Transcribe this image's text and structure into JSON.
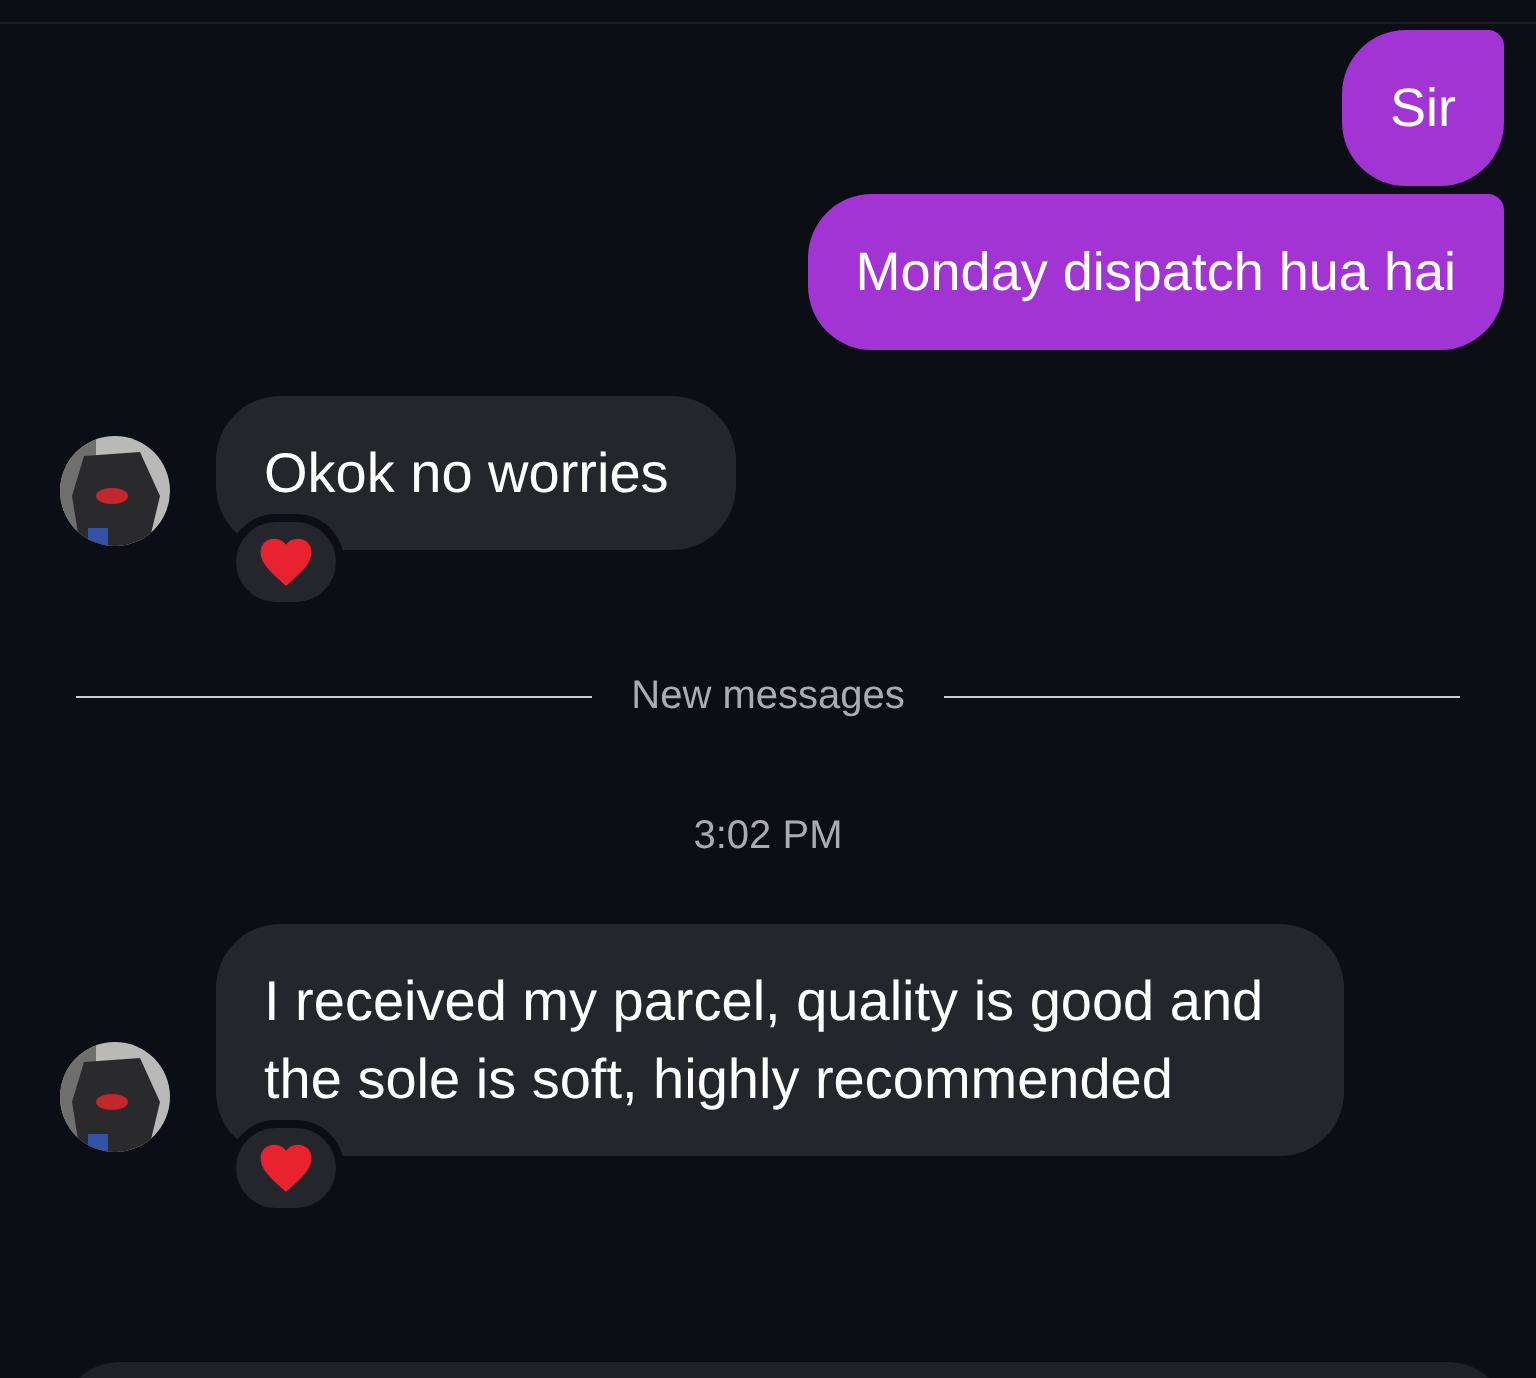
{
  "messages": [
    {
      "kind": "sent",
      "text": "Sir"
    },
    {
      "kind": "sent",
      "text": "Monday dispatch hua hai"
    },
    {
      "kind": "received",
      "text": "Okok no worries",
      "avatar": true,
      "reacted": true
    },
    {
      "kind": "divider",
      "text": "New messages"
    },
    {
      "kind": "time",
      "text": "3:02 PM"
    },
    {
      "kind": "received",
      "text": "I received my parcel, quality is good and the sole is soft, highly recommended",
      "avatar": true,
      "reacted": true
    }
  ]
}
